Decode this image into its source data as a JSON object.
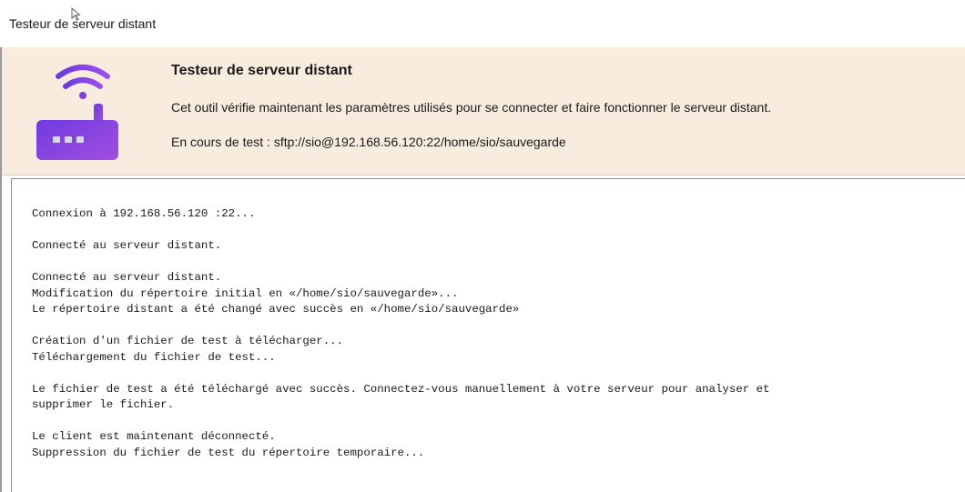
{
  "window": {
    "title": "Testeur de serveur distant"
  },
  "header": {
    "title": "Testeur de serveur distant",
    "description": "Cet outil vérifie maintenant les paramètres utilisés pour se connecter et faire fonctionner le serveur distant.",
    "status": "En cours de test : sftp://sio@192.168.56.120:22/home/sio/sauvegarde",
    "icon": "router-wifi-icon",
    "icon_colors": {
      "gradient_start": "#7b3fe4",
      "gradient_end": "#9d4edd",
      "wifi_stroke": "#7a3de0"
    }
  },
  "log": {
    "blocks": [
      [
        "Connexion à 192.168.56.120 :22..."
      ],
      [
        "Connecté au serveur distant."
      ],
      [
        "Connecté au serveur distant.",
        "Modification du répertoire initial en «/home/sio/sauvegarde»...",
        "Le répertoire distant a été changé avec succès en «/home/sio/sauvegarde»"
      ],
      [
        "Création d'un fichier de test à télécharger...",
        "Téléchargement du fichier de test..."
      ],
      [
        "Le fichier de test a été téléchargé avec succès. Connectez-vous manuellement à votre serveur pour analyser et",
        "supprimer le fichier."
      ],
      [
        "Le client est maintenant déconnecté.",
        "Suppression du fichier de test du répertoire temporaire..."
      ]
    ]
  }
}
